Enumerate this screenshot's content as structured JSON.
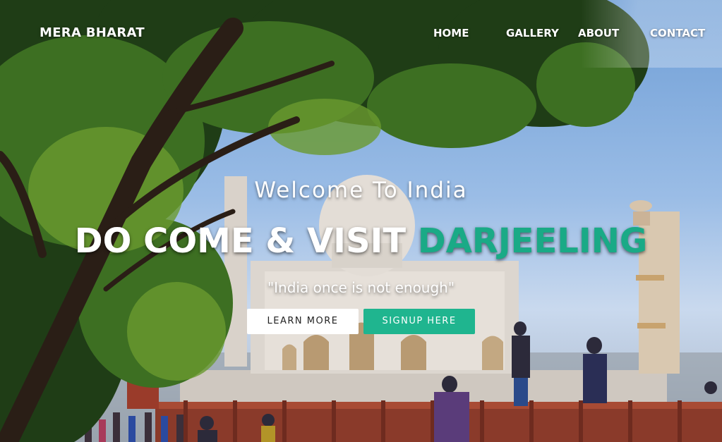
{
  "nav": {
    "brand": "MERA BHARAT",
    "links": [
      "HOME",
      "GALLERY",
      "ABOUT",
      "CONTACT"
    ]
  },
  "hero": {
    "welcome": "Welcome To India",
    "headline_main": "DO COME & VISIT",
    "headline_accent": "DARJEELING",
    "tagline": "\"India once is not enough\"",
    "learn_more": "LEARN MORE",
    "signup": "SIGNUP HERE"
  },
  "colors": {
    "accent": "#1aaa86",
    "signup_button": "#1fb58f"
  }
}
